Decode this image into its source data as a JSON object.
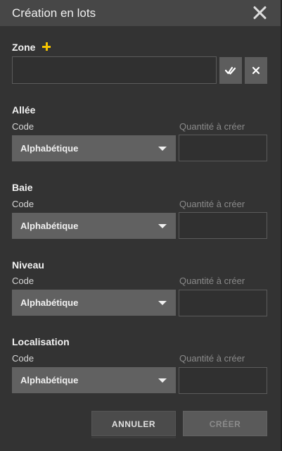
{
  "dialog": {
    "title": "Création en lots",
    "close_icon": "close-icon"
  },
  "zone": {
    "label": "Zone",
    "add_icon": "plus-icon",
    "add_icon_color": "#f5c400",
    "value": "",
    "validate_icon": "double-check-icon",
    "clear_icon": "x-icon"
  },
  "sections": [
    {
      "title": "Allée",
      "code_label": "Code",
      "qty_label": "Quantité à créer",
      "code_value": "Alphabétique",
      "qty_value": ""
    },
    {
      "title": "Baie",
      "code_label": "Code",
      "qty_label": "Quantité à créer",
      "code_value": "Alphabétique",
      "qty_value": ""
    },
    {
      "title": "Niveau",
      "code_label": "Code",
      "qty_label": "Quantité à créer",
      "code_value": "Alphabétique",
      "qty_value": ""
    },
    {
      "title": "Localisation",
      "code_label": "Code",
      "qty_label": "Quantité à créer",
      "code_value": "Alphabétique",
      "qty_value": ""
    }
  ],
  "footer": {
    "cancel_label": "ANNULER",
    "create_label": "CRÉER"
  }
}
